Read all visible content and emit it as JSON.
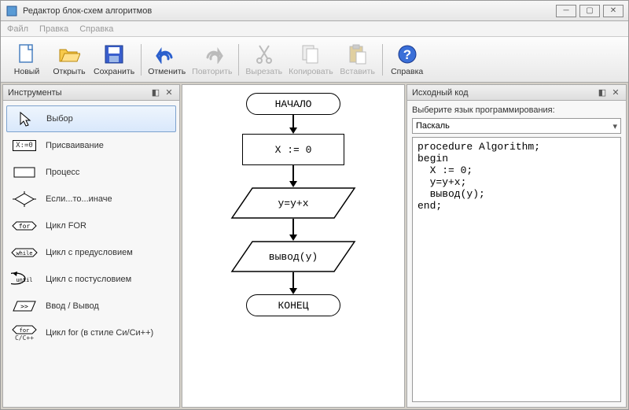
{
  "window": {
    "title": "Редактор блок-схем алгоритмов"
  },
  "menu": {
    "file": "Файл",
    "edit": "Правка",
    "help": "Справка"
  },
  "toolbar": {
    "new": "Новый",
    "open": "Открыть",
    "save": "Сохранить",
    "undo": "Отменить",
    "redo": "Повторить",
    "cut": "Вырезать",
    "copy": "Копировать",
    "paste": "Вставить",
    "help": "Справка"
  },
  "panels": {
    "tools_title": "Инструменты",
    "source_title": "Исходный код"
  },
  "tools": {
    "select": "Выбор",
    "assign": "Присваивание",
    "process": "Процесс",
    "ifelse": "Если...то...иначе",
    "for": "Цикл FOR",
    "while": "Цикл с предусловием",
    "until": "Цикл с постусловием",
    "io": "Ввод / Вывод",
    "cfor": "Цикл for (в стиле Си/Си++)"
  },
  "tool_icons": {
    "assign_text": "X:=0",
    "io_text": ">>",
    "for_text": "for",
    "while_text": "while",
    "until_text": "until",
    "cfor_top": "for",
    "cfor_bottom": "C/C++"
  },
  "flow": {
    "start": "НАЧАЛО",
    "assign": "X := 0",
    "proc": "y=y+x",
    "output": "вывод(y)",
    "end": "КОНЕЦ"
  },
  "source": {
    "lang_label": "Выберите язык программирования:",
    "lang_selected": "Паскаль",
    "code": "procedure Algorithm;\nbegin\n  X := 0;\n  y=y+x;\n  вывод(y);\nend;"
  }
}
